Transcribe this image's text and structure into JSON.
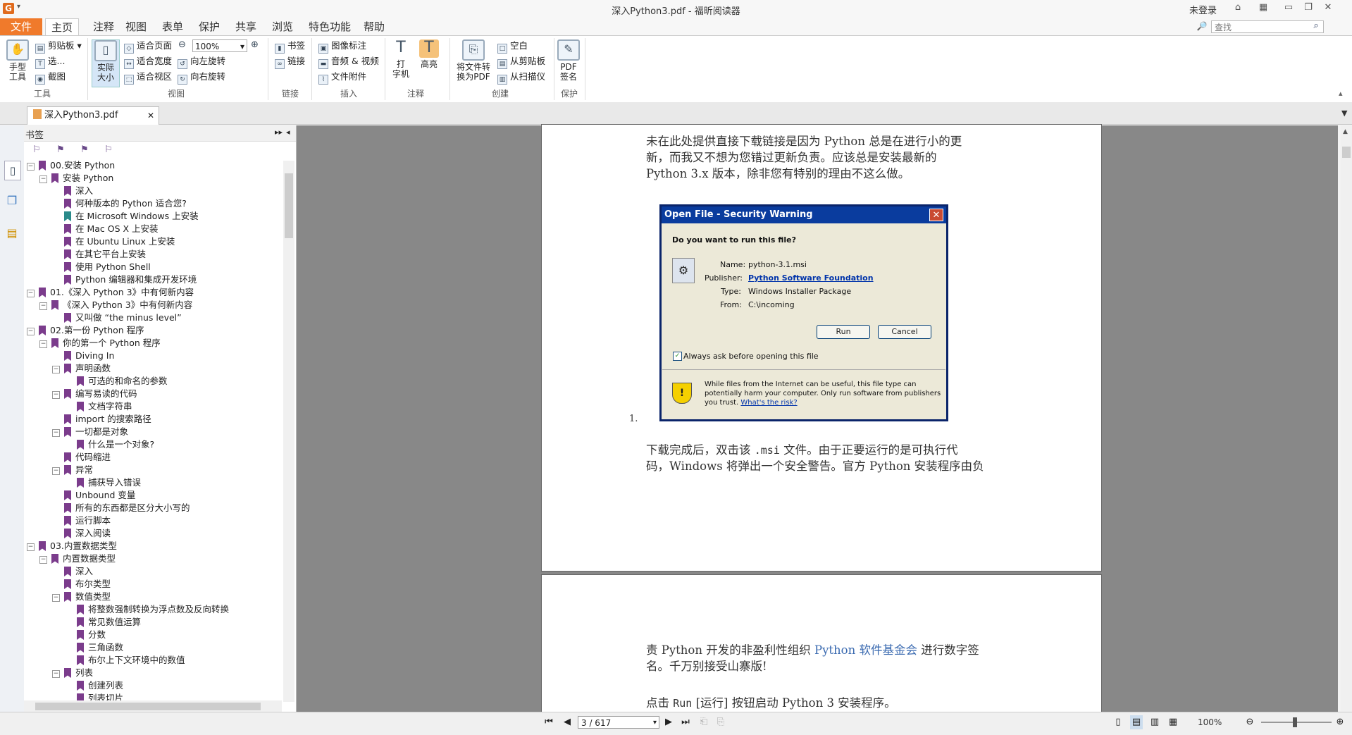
{
  "app": {
    "logo_glyph": "G",
    "title": "深入Python3.pdf - 福昕阅读器",
    "login": "未登录"
  },
  "tabs": [
    "文件",
    "主页",
    "注释",
    "视图",
    "表单",
    "保护",
    "共享",
    "浏览",
    "特色功能",
    "帮助"
  ],
  "search": {
    "placeholder": "查找"
  },
  "ribbon": {
    "tools": {
      "hand": "手型\n工具",
      "clipboard": "剪贴板",
      "select": "选...",
      "screenshot": "截图",
      "group": "工具"
    },
    "view": {
      "actual": "实际\n大小",
      "fit_page": "适合页面",
      "fit_width": "适合宽度",
      "fit_visible": "适合视区",
      "zoom": "100%",
      "rotate_left": "向左旋转",
      "rotate_right": "向右旋转",
      "group": "视图"
    },
    "links": {
      "bookmark": "书签",
      "link": "链接",
      "group": "链接"
    },
    "insert": {
      "image": "图像标注",
      "audio": "音频 & 视频",
      "attach": "文件附件",
      "group": "插入"
    },
    "comment": {
      "typewriter": "打\n字机",
      "highlight": "高亮",
      "group": "注释"
    },
    "create": {
      "to_pdf": "将文件转\n换为PDF",
      "blank": "空白",
      "from_clipboard": "从剪贴板",
      "from_scanner": "从扫描仪",
      "group": "创建"
    },
    "protect": {
      "sign": "PDF\n签名",
      "group": "保护"
    }
  },
  "doc_tab": {
    "name": "深入Python3.pdf"
  },
  "bookmarks": {
    "title": "书签",
    "items": [
      {
        "level": 0,
        "exp": "−",
        "text": "00.安装 Python"
      },
      {
        "level": 1,
        "exp": "−",
        "text": "安装 Python"
      },
      {
        "level": 2,
        "exp": "",
        "text": "深入"
      },
      {
        "level": 2,
        "exp": "",
        "text": "何种版本的 Python 适合您?"
      },
      {
        "level": 2,
        "exp": "",
        "text": "在 Microsoft Windows 上安装",
        "teal": true
      },
      {
        "level": 2,
        "exp": "",
        "text": "在 Mac OS X 上安装"
      },
      {
        "level": 2,
        "exp": "",
        "text": "在 Ubuntu Linux 上安装"
      },
      {
        "level": 2,
        "exp": "",
        "text": "在其它平台上安装"
      },
      {
        "level": 2,
        "exp": "",
        "text": "使用 Python Shell"
      },
      {
        "level": 2,
        "exp": "",
        "text": "Python 编辑器和集成开发环境"
      },
      {
        "level": 0,
        "exp": "−",
        "text": "01.《深入 Python 3》中有何新内容"
      },
      {
        "level": 1,
        "exp": "−",
        "text": "《深入 Python 3》中有何新内容"
      },
      {
        "level": 2,
        "exp": "",
        "text": "又叫做 “the minus level”"
      },
      {
        "level": 0,
        "exp": "−",
        "text": "02.第一份 Python 程序"
      },
      {
        "level": 1,
        "exp": "−",
        "text": "你的第一个 Python 程序"
      },
      {
        "level": 2,
        "exp": "",
        "text": "Diving In"
      },
      {
        "level": 2,
        "exp": "−",
        "text": "声明函数"
      },
      {
        "level": 3,
        "exp": "",
        "text": "可选的和命名的参数"
      },
      {
        "level": 2,
        "exp": "−",
        "text": "编写易读的代码"
      },
      {
        "level": 3,
        "exp": "",
        "text": "文档字符串"
      },
      {
        "level": 2,
        "exp": "",
        "text": "import 的搜索路径"
      },
      {
        "level": 2,
        "exp": "−",
        "text": "一切都是对象"
      },
      {
        "level": 3,
        "exp": "",
        "text": "什么是一个对象?"
      },
      {
        "level": 2,
        "exp": "",
        "text": "代码缩进"
      },
      {
        "level": 2,
        "exp": "−",
        "text": "异常"
      },
      {
        "level": 3,
        "exp": "",
        "text": "捕获导入错误"
      },
      {
        "level": 2,
        "exp": "",
        "text": "Unbound 变量"
      },
      {
        "level": 2,
        "exp": "",
        "text": "所有的东西都是区分大小写的"
      },
      {
        "level": 2,
        "exp": "",
        "text": "运行脚本"
      },
      {
        "level": 2,
        "exp": "",
        "text": "深入阅读"
      },
      {
        "level": 0,
        "exp": "−",
        "text": "03.内置数据类型"
      },
      {
        "level": 1,
        "exp": "−",
        "text": "内置数据类型"
      },
      {
        "level": 2,
        "exp": "",
        "text": "深入"
      },
      {
        "level": 2,
        "exp": "",
        "text": "布尔类型"
      },
      {
        "level": 2,
        "exp": "−",
        "text": "数值类型"
      },
      {
        "level": 3,
        "exp": "",
        "text": "将整数强制转换为浮点数及反向转换"
      },
      {
        "level": 3,
        "exp": "",
        "text": "常见数值运算"
      },
      {
        "level": 3,
        "exp": "",
        "text": "分数"
      },
      {
        "level": 3,
        "exp": "",
        "text": "三角函数"
      },
      {
        "level": 3,
        "exp": "",
        "text": "布尔上下文环境中的数值"
      },
      {
        "level": 2,
        "exp": "−",
        "text": "列表"
      },
      {
        "level": 3,
        "exp": "",
        "text": "创建列表"
      },
      {
        "level": 3,
        "exp": "",
        "text": "列表切片"
      }
    ]
  },
  "page1": {
    "lines": [
      "未在此处提供直接下载链接是因为 Python 总是在进行小的更",
      "新，而我又不想为您错过更新负责。应该总是安装最新的",
      "Python 3.x 版本，除非您有特别的理由不这么做。"
    ],
    "list_num": "1.",
    "after1_a": "下载完成后，双击该 ",
    "after1_code": ".msi",
    "after1_b": " 文件。由于正要运行的是可执行代",
    "after2": "码，Windows 将弹出一个安全警告。官方 Python 安装程序由负"
  },
  "dialog": {
    "title": "Open File - Security Warning",
    "question": "Do you want to run this file?",
    "name_label": "Name:",
    "name_value": "python-3.1.msi",
    "publisher_label": "Publisher:",
    "publisher_value": "Python Software Foundation",
    "type_label": "Type:",
    "type_value": "Windows Installer Package",
    "from_label": "From:",
    "from_value": "C:\\incoming",
    "run": "Run",
    "cancel": "Cancel",
    "always_ask": "Always ask before opening this file",
    "warn1": "While files from the Internet can be useful, this file type can",
    "warn2": "potentially harm your computer. Only run software from publishers",
    "warn3": "you trust.",
    "warn_link": "What's the risk?"
  },
  "page2": {
    "l1a": "责 Python 开发的非盈利性组织 ",
    "l1link": "Python 软件基金会",
    "l1b": " 进行数字签",
    "l2": "名。千万别接受山寨版!",
    "l3a": "点击 ",
    "l3code": "Run",
    "l3b": " [运行] 按钮启动 Python 3 安装程序。"
  },
  "status": {
    "page": "3 / 617",
    "zoom": "100%"
  }
}
